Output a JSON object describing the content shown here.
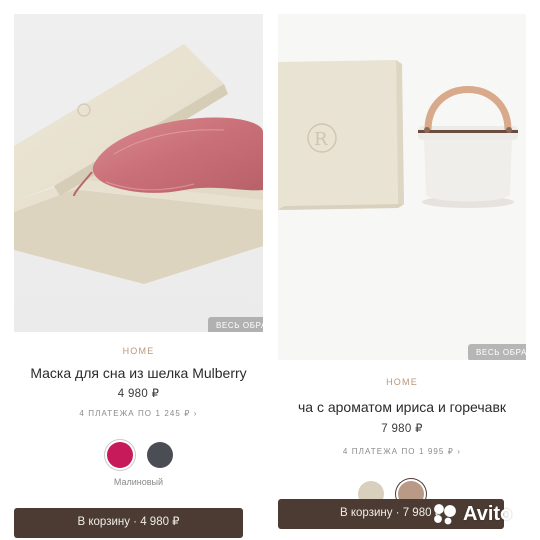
{
  "left": {
    "view_all": "ВЕСЬ ОБРА",
    "category": "HOME",
    "title": "Маска для сна из шелка Mulberry",
    "price": "4 980 ₽",
    "installments": "4 ПЛАТЕЖА ПО 1 245 ₽ ›",
    "swatches": [
      {
        "name": "Малиновый",
        "color": "#c71a5b",
        "selected": true
      },
      {
        "name": "dark-grey",
        "color": "#4a4d53",
        "selected": false
      }
    ],
    "selected_color_label": "Малиновый",
    "cart_label": "В корзину · 4 980 ₽",
    "active_slide": 4,
    "slide_count": 8
  },
  "right": {
    "view_all": "ВЕСЬ ОБРА",
    "category": "HOME",
    "title": "ча с ароматом ириса и горечавк",
    "price": "7 980 ₽",
    "installments": "4 ПЛАТЕЖА ПО 1 995 ₽ ›",
    "cart_label": "В корзину · 7 980 ₽"
  },
  "watermark": {
    "brand": "Avito"
  },
  "colors": {
    "accent_category": "#b8977a",
    "cart_button": "#4b3b33",
    "swatch_raspberry": "#c71a5b",
    "swatch_grey": "#4a4d53"
  }
}
